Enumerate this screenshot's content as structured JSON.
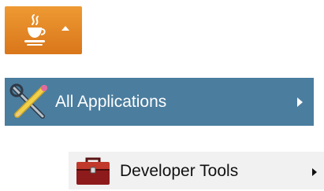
{
  "app_button": {
    "icon": "java-cup-icon",
    "dropdown_icon": "caret-up-icon",
    "color": "#e58a2a"
  },
  "menu": {
    "all_applications": {
      "label": "All Applications",
      "icon": "tools-icon",
      "submenu_icon": "chevron-right-icon",
      "color": "#4b7d9e"
    },
    "developer_tools": {
      "label": "Developer Tools",
      "icon": "toolbox-icon",
      "submenu_icon": "chevron-right-icon"
    }
  }
}
